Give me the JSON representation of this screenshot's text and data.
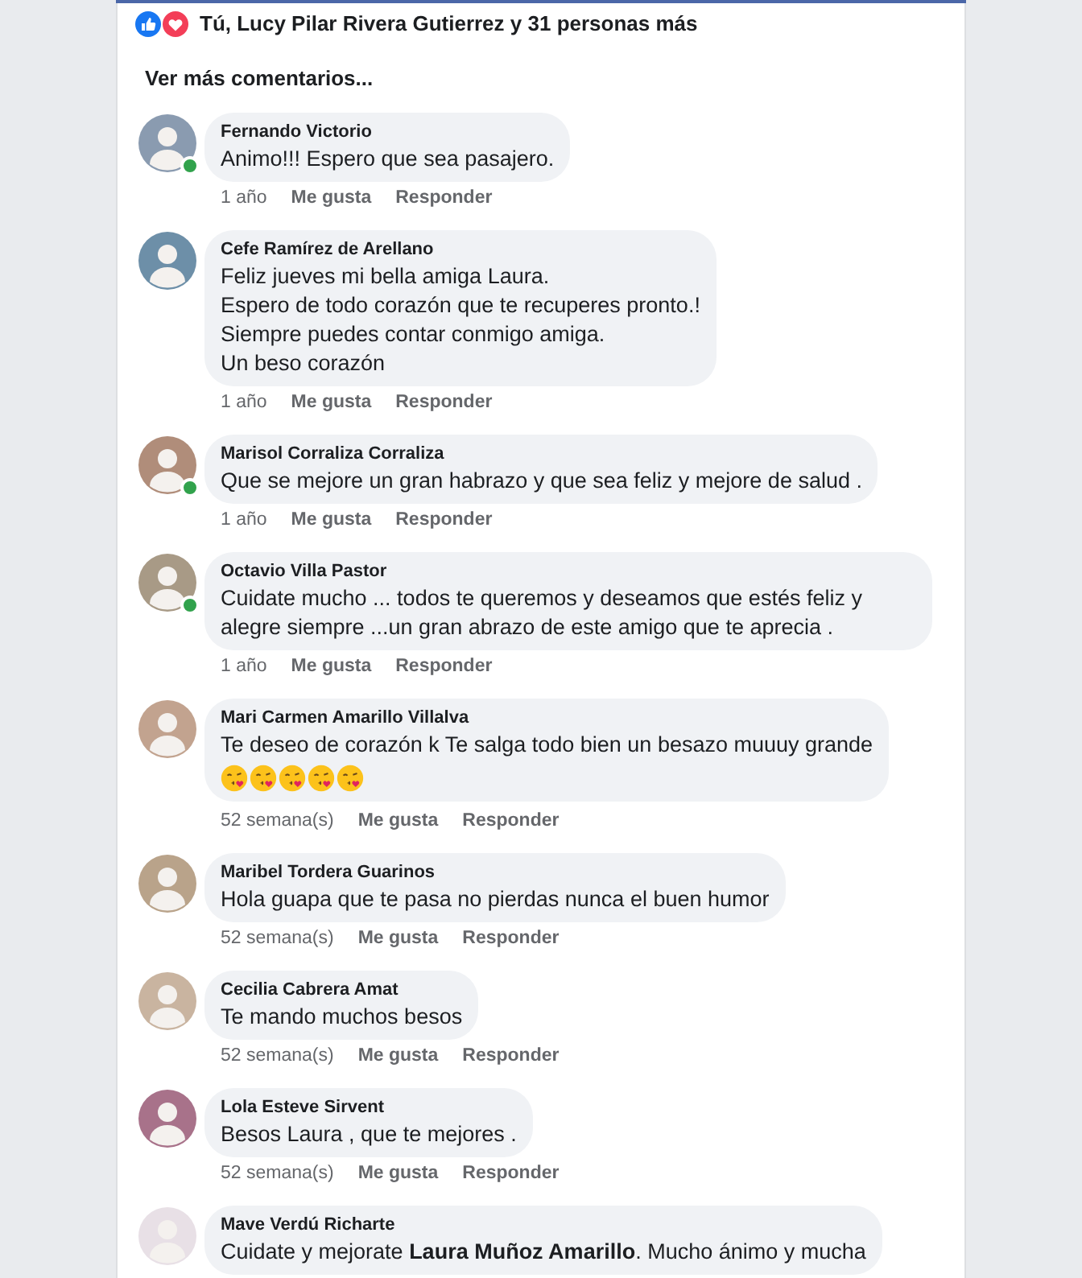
{
  "reactions": {
    "icons": [
      {
        "kind": "like"
      },
      {
        "kind": "love"
      }
    ],
    "summary": "Tú, Lucy Pilar Rivera Gutierrez y 31 personas más"
  },
  "more_comments": "Ver más comentarios...",
  "comments": [
    {
      "author": "Fernando Victorio",
      "online": true,
      "lines": [
        "Animo!!! Espero que sea pasajero."
      ],
      "time": "1 año",
      "like": "Me gusta",
      "reply": "Responder"
    },
    {
      "author": "Cefe Ramírez de Arellano",
      "online": false,
      "lines": [
        "Feliz jueves mi bella amiga Laura.",
        "Espero de todo corazón que te recuperes pronto.!",
        "Siempre puedes contar conmigo amiga.",
        "Un beso corazón"
      ],
      "time": "1 año",
      "like": "Me gusta",
      "reply": "Responder"
    },
    {
      "author": "Marisol Corraliza Corraliza",
      "online": true,
      "lines": [
        "Que se mejore un gran habrazo y que sea feliz y mejore de salud ."
      ],
      "time": "1 año",
      "like": "Me gusta",
      "reply": "Responder"
    },
    {
      "author": "Octavio Villa Pastor",
      "online": true,
      "lines": [
        "Cuidate mucho ... todos te queremos y deseamos que estés feliz y alegre siempre ...un gran abrazo de este amigo que te aprecia ."
      ],
      "time": "1 año",
      "like": "Me gusta",
      "reply": "Responder"
    },
    {
      "author": "Mari Carmen Amarillo Villalva",
      "online": false,
      "lines": [
        "Te deseo de corazón k Te salga todo bien un besazo muuuy grande"
      ],
      "emojis": [
        {
          "kind": "kiss"
        },
        {
          "kind": "kiss"
        },
        {
          "kind": "kiss"
        },
        {
          "kind": "kiss"
        },
        {
          "kind": "kiss"
        }
      ],
      "time": "52 semana(s)",
      "like": "Me gusta",
      "reply": "Responder"
    },
    {
      "author": "Maribel Tordera Guarinos",
      "online": false,
      "lines": [
        "Hola guapa que te pasa no pierdas nunca el buen humor"
      ],
      "time": "52 semana(s)",
      "like": "Me gusta",
      "reply": "Responder"
    },
    {
      "author": "Cecilia Cabrera Amat",
      "online": false,
      "lines": [
        "Te mando muchos besos"
      ],
      "time": "52 semana(s)",
      "like": "Me gusta",
      "reply": "Responder"
    },
    {
      "author": "Lola Esteve Sirvent",
      "online": false,
      "lines": [
        "Besos Laura , que te mejores  ."
      ],
      "time": "52 semana(s)",
      "like": "Me gusta",
      "reply": "Responder"
    },
    {
      "author": "Mave Verdú Richarte",
      "online": false,
      "lines": [
        "Cuidate y mejorate **Laura Muñoz Amarillo**. Mucho ánimo y mucha"
      ]
    }
  ]
}
